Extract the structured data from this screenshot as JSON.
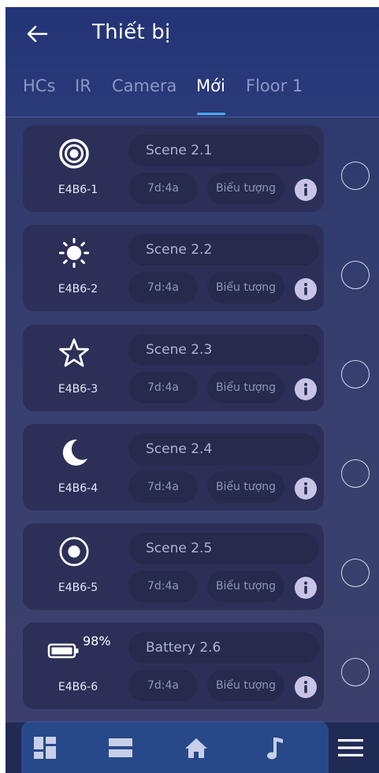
{
  "header": {
    "title": "Thiết bị"
  },
  "tabs": [
    {
      "label": "HCs"
    },
    {
      "label": "IR"
    },
    {
      "label": "Camera"
    },
    {
      "label": "Mới"
    },
    {
      "label": "Floor 1"
    }
  ],
  "active_tab": "Mới",
  "devices": [
    {
      "code": "E4B6-1",
      "scene": "Scene 2.1",
      "time": "7d:4a",
      "icon_label": "Biểu tượng",
      "icon": "target-icon"
    },
    {
      "code": "E4B6-2",
      "scene": "Scene 2.2",
      "time": "7d:4a",
      "icon_label": "Biểu tượng",
      "icon": "sun-icon"
    },
    {
      "code": "E4B6-3",
      "scene": "Scene 2.3",
      "time": "7d:4a",
      "icon_label": "Biểu tượng",
      "icon": "star-icon"
    },
    {
      "code": "E4B6-4",
      "scene": "Scene 2.4",
      "time": "7d:4a",
      "icon_label": "Biểu tượng",
      "icon": "moon-icon"
    },
    {
      "code": "E4B6-5",
      "scene": "Scene 2.5",
      "time": "7d:4a",
      "icon_label": "Biểu tượng",
      "icon": "record-icon"
    },
    {
      "code": "E4B6-6",
      "scene": "Battery 2.6",
      "time": "7d:4a",
      "icon_label": "Biểu tượng",
      "icon": "battery-icon",
      "battery": "98%"
    }
  ],
  "colors": {
    "accent": "#4aa8f0",
    "card": "#2c3058",
    "pill": "#262a4d",
    "info": "#c9c4e6"
  }
}
